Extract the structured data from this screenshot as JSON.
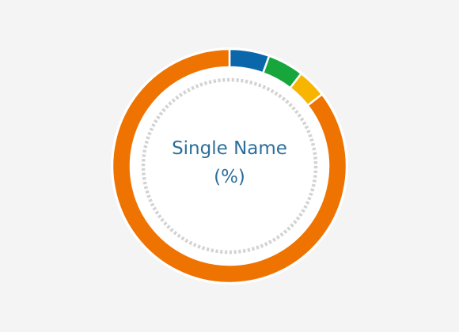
{
  "chart_data": {
    "type": "pie",
    "style": "donut",
    "title": "Single Name",
    "unit": "(%)",
    "slices": [
      {
        "value": 5.5,
        "color": "#0a68aa"
      },
      {
        "value": 5.0,
        "color": "#16a63c"
      },
      {
        "value": 4.0,
        "color": "#f7b500"
      },
      {
        "value": 85.5,
        "color": "#ef7300"
      }
    ],
    "start_angle_deg": 0,
    "direction": "clockwise",
    "separator_color": "#ffffff",
    "inner_ring": {
      "style": "dashed",
      "color": "#d3d3d3"
    },
    "label_color": "#2c6e9b",
    "background": "#f4f4f4"
  }
}
